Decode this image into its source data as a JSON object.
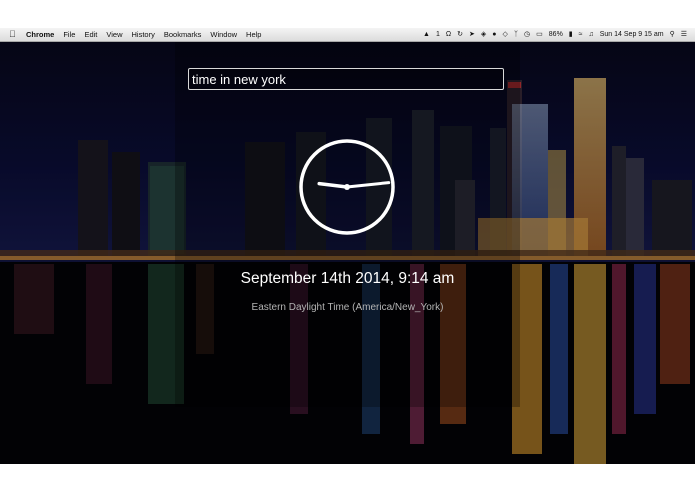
{
  "menubar": {
    "app_name": "Chrome",
    "items": [
      "File",
      "Edit",
      "View",
      "History",
      "Bookmarks",
      "Window",
      "Help"
    ],
    "status": {
      "badge_one": "1",
      "battery": "86%",
      "clock": "Sun 14 Sep  9 15 am"
    }
  },
  "search": {
    "value": "time in new york"
  },
  "clock": {
    "hour": 9,
    "minute": 14
  },
  "result": {
    "datetime": "September 14th 2014, 9:14 am",
    "timezone": "Eastern Daylight Time (America/New_York)"
  },
  "colors": {
    "accent_white": "#ffffff",
    "subtle_text": "#b4b4b4"
  }
}
